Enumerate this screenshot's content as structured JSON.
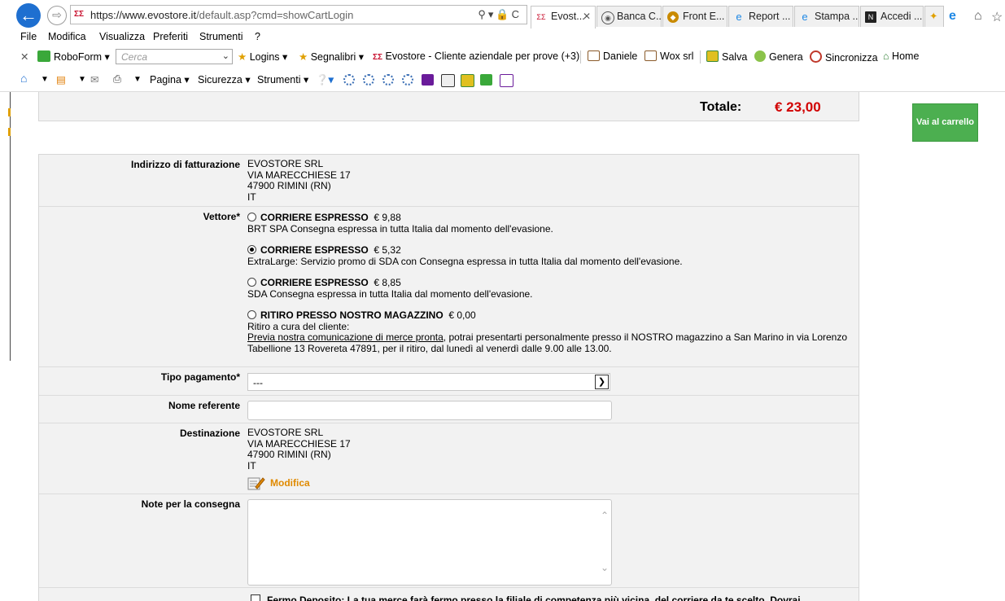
{
  "browser": {
    "url_main": "https://www.evostore.it",
    "url_rest": "/default.asp?cmd=showCartLogin",
    "tabs": [
      {
        "label": "Evost...",
        "active": true
      },
      {
        "label": "Banca C..."
      },
      {
        "label": "Front E..."
      },
      {
        "label": "Report ..."
      },
      {
        "label": "Stampa ..."
      },
      {
        "label": "Accedi ..."
      }
    ],
    "menu": [
      "File",
      "Modifica",
      "Visualizza",
      "Preferiti",
      "Strumenti",
      "?"
    ],
    "favorites": {
      "roboform": "RoboForm",
      "search_placeholder": "Cerca",
      "logins": "Logins",
      "segnalibri": "Segnalibri",
      "evostore": "Evostore - Cliente aziendale per prove (+3)",
      "daniele": "Daniele",
      "wox": "Wox srl",
      "salva": "Salva",
      "genera": "Genera",
      "sincronizza": "Sincronizza",
      "home": "Home"
    },
    "command": {
      "pagina": "Pagina",
      "sicurezza": "Sicurezza",
      "strumenti": "Strumenti"
    }
  },
  "cart": {
    "total_label": "Totale:",
    "total_value": "€ 23,00",
    "go_to_cart": "Vai al carrello"
  },
  "form": {
    "billing": {
      "label": "Indirizzo di fatturazione",
      "lines": [
        "EVOSTORE SRL",
        "VIA MARECCHIESE 17",
        "47900 RIMINI (RN)",
        "IT"
      ]
    },
    "carrier": {
      "label": "Vettore*",
      "options": [
        {
          "title": "CORRIERE ESPRESSO",
          "price": "€ 9,88",
          "desc": "BRT SPA Consegna espressa in tutta Italia dal momento dell'evasione.",
          "selected": false
        },
        {
          "title": "CORRIERE ESPRESSO",
          "price": "€ 5,32",
          "desc": "ExtraLarge: Servizio promo di SDA con Consegna espressa in tutta Italia dal momento dell'evasione.",
          "selected": true
        },
        {
          "title": "CORRIERE ESPRESSO",
          "price": "€ 8,85",
          "desc": "SDA Consegna espressa in tutta Italia dal momento dell'evasione.",
          "selected": false
        },
        {
          "title": "RITIRO PRESSO NOSTRO MAGAZZINO",
          "price": "€ 0,00",
          "desc": "Ritiro a cura del cliente:",
          "selected": false
        }
      ],
      "pickup_link": "Previa nostra comunicazione di merce pronta",
      "pickup_rest": ", potrai presentarti personalmente presso il NOSTRO magazzino a San Marino in via Lorenzo",
      "pickup_rest2": "Tabellione 13 Rovereta 47891, per il ritiro, dal lunedì al venerdì dalle 9.00 alle 13.00."
    },
    "payment": {
      "label": "Tipo pagamento*",
      "value": "---"
    },
    "referent": {
      "label": "Nome referente",
      "value": ""
    },
    "destination": {
      "label": "Destinazione",
      "lines": [
        "EVOSTORE SRL",
        "VIA MARECCHIESE 17",
        "47900 RIMINI (RN)",
        "IT"
      ],
      "edit": "Modifica"
    },
    "notes": {
      "label": "Note per la consegna",
      "value": ""
    },
    "fermo": {
      "text": "Fermo Deposito: La tua merce farà fermo presso la filiale di competenza più vicina, del corriere da te scelto. Dovrai"
    }
  },
  "colors": {
    "total": "#d10000",
    "cart_button": "#4caf50",
    "edit_link": "#e08a00",
    "back_button": "#1e6fd0"
  }
}
